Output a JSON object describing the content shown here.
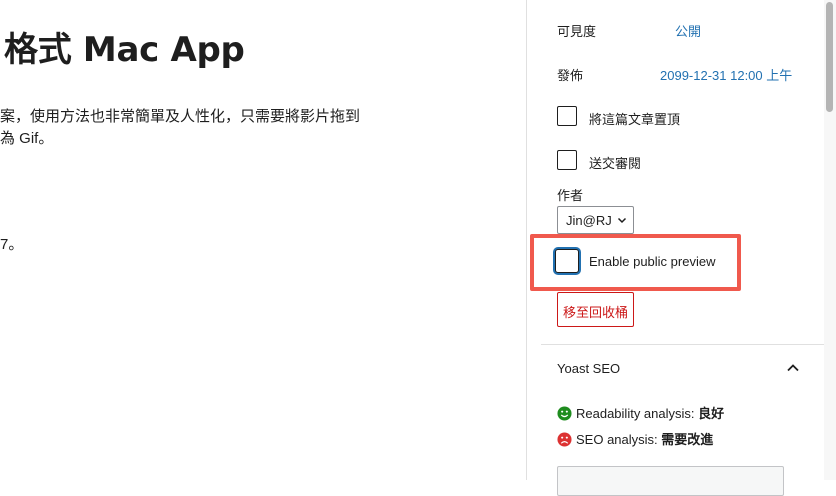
{
  "editor": {
    "title": "格式 Mac App",
    "para_line1": "案，使用方法也非常簡單及人性化，只需要將影片拖到",
    "para_line2": "為 Gif。",
    "para_line3": "7。"
  },
  "sidebar": {
    "visibility": {
      "label": "可見度",
      "value": "公開"
    },
    "publish": {
      "label": "發佈",
      "value": "2099-12-31 12:00 上午"
    },
    "sticky_label": "將這篇文章置頂",
    "pending_label": "送交審閱",
    "author": {
      "label": "作者",
      "value": "Jin@RJ"
    },
    "public_preview_label": "Enable public preview",
    "trash_label": "移至回收桶",
    "yoast": {
      "title": "Yoast SEO",
      "readability_label": "Readability analysis: ",
      "readability_value": "良好",
      "seo_label": "SEO analysis: ",
      "seo_value": "需要改進"
    }
  },
  "colors": {
    "link": "#2271b1",
    "highlight": "#f0594d",
    "danger": "#cc1818",
    "good": "#1e8c1e",
    "bad": "#dc3232"
  },
  "icons": [
    "chevron-down-icon",
    "chevron-up-icon",
    "smiley-good-icon",
    "smiley-bad-icon"
  ]
}
